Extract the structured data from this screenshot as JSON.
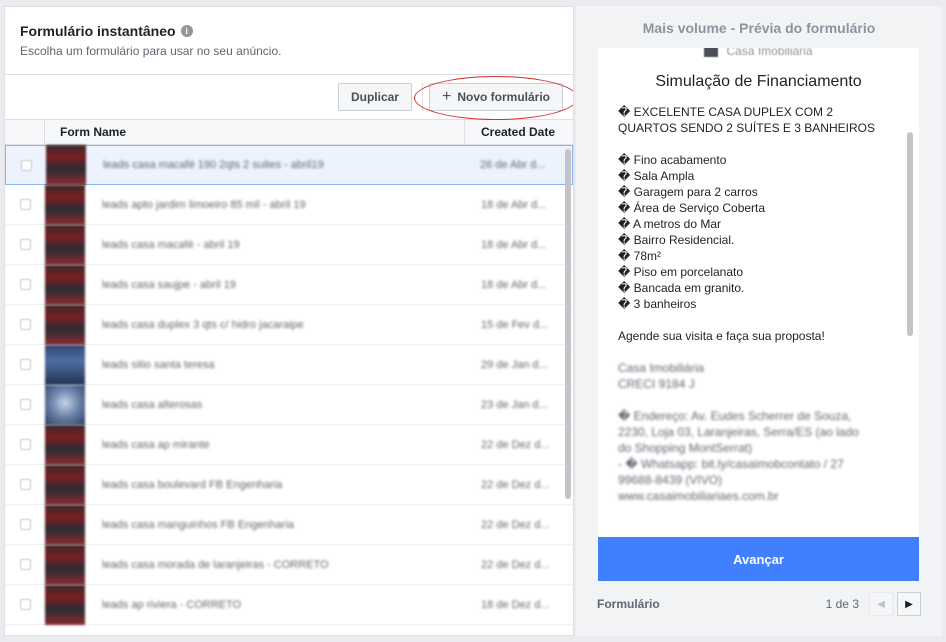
{
  "left_panel": {
    "title": "Formulário instantâneo",
    "info_icon": "i",
    "subtitle": "Escolha um formulário para usar no seu anúncio.",
    "duplicate_label": "Duplicar",
    "new_form_icon": "+",
    "new_form_label": "Novo formulário",
    "columns": {
      "name": "Form Name",
      "date": "Created Date"
    },
    "rows": [
      {
        "name": "leads casa macafé 190 2qts 2 suites - abril19",
        "date": "26 de Abr d...",
        "selected": true
      },
      {
        "name": "leads apto jardim limoeiro 85 mil - abril 19",
        "date": "18 de Abr d..."
      },
      {
        "name": "leads casa macafé - abril 19",
        "date": "18 de Abr d..."
      },
      {
        "name": "leads casa saujpe - abril 19",
        "date": "18 de Abr d..."
      },
      {
        "name": "leads casa duplex 3 qts c/ hidro jacaraipe",
        "date": "15 de Fev d..."
      },
      {
        "name": "leads sitio santa teresa",
        "date": "29 de Jan d..."
      },
      {
        "name": "leads casa alterosas",
        "date": "23 de Jan d..."
      },
      {
        "name": "leads casa ap mirante",
        "date": "22 de Dez d..."
      },
      {
        "name": "leads casa boulevard FB Engenharia",
        "date": "22 de Dez d..."
      },
      {
        "name": "leads casa manguinhos FB Engenharia",
        "date": "22 de Dez d..."
      },
      {
        "name": "leads casa morada de laranjeiras - CORRETO",
        "date": "22 de Dez d..."
      },
      {
        "name": "leads ap riviera - CORRETO",
        "date": "18 de Dez d..."
      }
    ]
  },
  "right_panel": {
    "title": "Mais volume - Prévia do formulário",
    "brand": "Casa Imobiliária",
    "form_title": "Simulação de Financiamento",
    "headline": [
      "� EXCELENTE CASA DUPLEX COM 2",
      "QUARTOS SENDO 2 SUÍTES E 3 BANHEIROS"
    ],
    "features": [
      "� Fino acabamento",
      "� Sala Ampla",
      "� Garagem para 2 carros",
      "� Área de Serviço Coberta",
      "� A metros do Mar",
      "� Bairro Residencial.",
      "� 78m²",
      "� Piso em porcelanato",
      "� Bancada em granito.",
      "� 3 banheiros"
    ],
    "cta": "Agende sua visita e faça sua proposta!",
    "contact": [
      "Casa Imobiliária",
      "CRECI 9184 J"
    ],
    "address": [
      "� Endereço: Av. Eudes Scherrer de Souza,",
      "2230, Loja 03, Laranjeiras, Serra/ES (ao lado",
      "do Shopping MontSerrat)",
      "- � Whatsapp: bit.ly/casaimobcontato / 27",
      "99688-8439 (VIVO)",
      "www.casaimobiliariaes.com.br"
    ],
    "advance_label": "Avançar",
    "footer_label": "Formulário",
    "page_indicator": "1 de 3",
    "prev_icon": "◀",
    "next_icon": "▶"
  }
}
